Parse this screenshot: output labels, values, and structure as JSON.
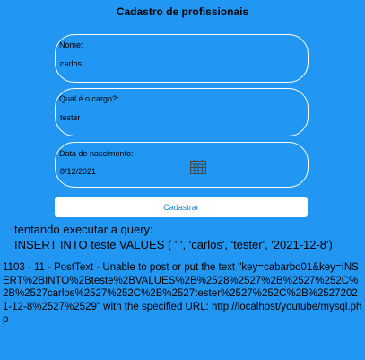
{
  "page": {
    "title": "Cadastro de profissionais"
  },
  "form": {
    "name": {
      "label": "Nome:",
      "value": "carlos"
    },
    "role": {
      "label": "Qual é o cargo?:",
      "value": "tester"
    },
    "birthdate": {
      "label": "Data de nascimento:",
      "value": "8/12/2021",
      "icon": "calendar-icon"
    },
    "submit_label": "Cadastrar"
  },
  "output": {
    "query_label": "tentando executar a query:",
    "query": "INSERT INTO teste VALUES ( ' ', 'carlos', 'tester', '2021-12-8')",
    "error": "1103 - 11 - PostText - Unable to post or put the text \"key=cabarbo01&key=INSERT%2BINTO%2Bteste%2BVALUES%2B%2528%2527%2B%2527%252C%2B%2527carlos%2527%252C%2B%2527tester%2527%252C%2B%25272021-12-8%2527%2529\" with the specified URL: http://localhost/youtube/mysql.php"
  },
  "colors": {
    "background": "#2196f3",
    "border": "#ffffff",
    "button_text": "#1e88e5"
  }
}
